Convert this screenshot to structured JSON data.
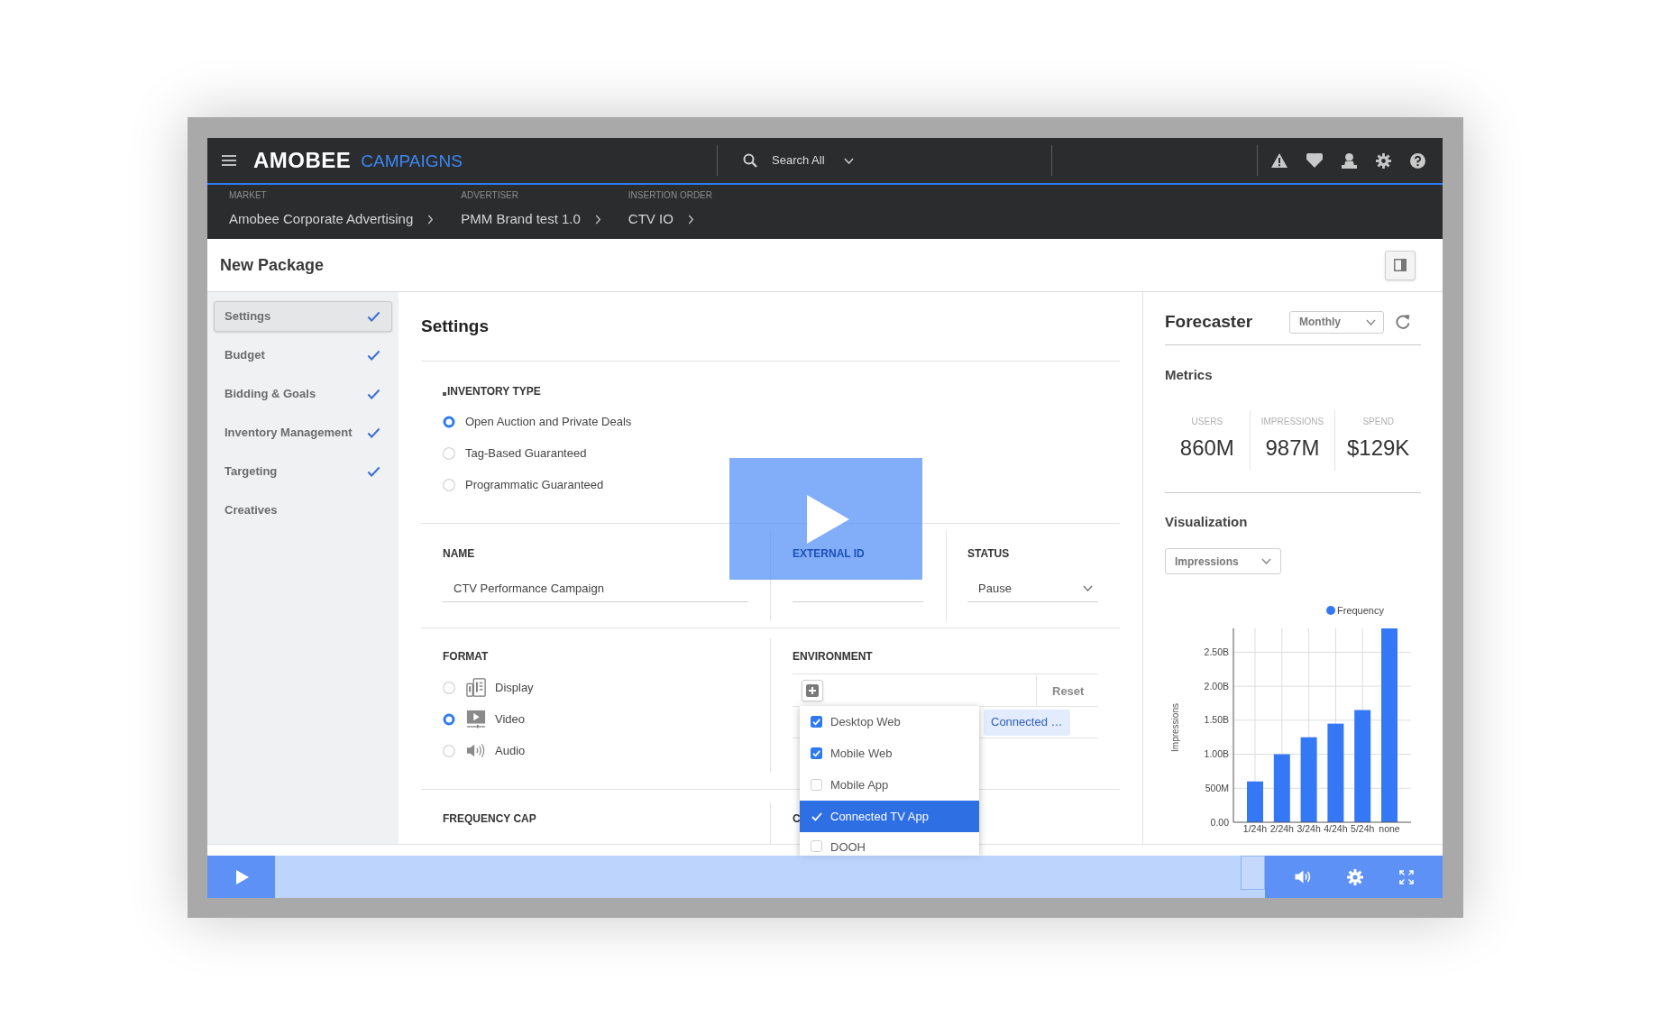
{
  "top_bar": {
    "logo": "AMOBEE",
    "product": "CAMPAIGNS",
    "search": "Search All"
  },
  "breadcrumbs": [
    {
      "label": "MARKET",
      "value": "Amobee Corporate Advertising"
    },
    {
      "label": "ADVERTISER",
      "value": "PMM Brand test 1.0"
    },
    {
      "label": "INSERTION ORDER",
      "value": "CTV IO"
    }
  ],
  "page_title": "New Package",
  "steps": [
    {
      "label": "Settings",
      "selected": true,
      "completed": true
    },
    {
      "label": "Budget",
      "selected": false,
      "completed": true
    },
    {
      "label": "Bidding & Goals",
      "selected": false,
      "completed": true
    },
    {
      "label": "Inventory Management",
      "selected": false,
      "completed": true
    },
    {
      "label": "Targeting",
      "selected": false,
      "completed": true
    },
    {
      "label": "Creatives",
      "selected": false,
      "completed": false
    }
  ],
  "settings": {
    "title": "Settings",
    "inventory_type": {
      "label": "INVENTORY TYPE",
      "required": true,
      "options": [
        {
          "label": "Open Auction and Private Deals",
          "selected": true
        },
        {
          "label": "Tag-Based Guaranteed",
          "selected": false
        },
        {
          "label": "Programmatic Guaranteed",
          "selected": false
        }
      ]
    },
    "name": {
      "label": "NAME",
      "value": "CTV Performance Campaign"
    },
    "external_id": {
      "label": "EXTERNAL ID"
    },
    "status": {
      "label": "STATUS",
      "value": "Pause"
    },
    "format": {
      "label": "FORMAT",
      "options": [
        {
          "kind": "display",
          "label": "Display",
          "selected": false
        },
        {
          "kind": "video",
          "label": "Video",
          "selected": true
        },
        {
          "kind": "audio",
          "label": "Audio",
          "selected": false
        }
      ]
    },
    "environment": {
      "label": "ENVIRONMENT",
      "reset": "Reset",
      "chips": [
        "Connected …"
      ],
      "menu": [
        {
          "label": "Desktop Web",
          "checked": true,
          "selected": false
        },
        {
          "label": "Mobile Web",
          "checked": true,
          "selected": false
        },
        {
          "label": "Mobile App",
          "checked": false,
          "selected": false
        },
        {
          "label": "Connected TV App",
          "checked": true,
          "selected": true
        },
        {
          "label": "DOOH",
          "checked": false,
          "selected": false
        }
      ]
    },
    "frequency_cap": {
      "label": "FREQUENCY CAP"
    },
    "column_4": {
      "label": "C"
    }
  },
  "forecaster": {
    "title": "Forecaster",
    "period": "Monthly",
    "metrics_title": "Metrics",
    "metrics": [
      {
        "label": "USERS",
        "value": "860M"
      },
      {
        "label": "IMPRESSIONS",
        "value": "987M"
      },
      {
        "label": "SPEND",
        "value": "$129K"
      }
    ],
    "visualization_title": "Visualization",
    "measure": "Impressions",
    "chart_data": {
      "type": "bar",
      "ylabel": "Impressions",
      "grid": true,
      "categories": [
        "1/24h",
        "2/24h",
        "3/24h",
        "4/24h",
        "5/24h",
        "none"
      ],
      "series": [
        {
          "name": "Frequency",
          "color": "#3478f6",
          "values": [
            600000000,
            1000000000,
            1250000000,
            1450000000,
            1650000000,
            2850000000
          ]
        }
      ],
      "ylim": [
        0,
        2850000000
      ],
      "yticks": [
        {
          "value": 0,
          "label": "0.00"
        },
        {
          "value": 500000000,
          "label": "500M"
        },
        {
          "value": 1000000000,
          "label": "1.00B"
        },
        {
          "value": 1500000000,
          "label": "1.50B"
        },
        {
          "value": 2000000000,
          "label": "2.00B"
        },
        {
          "value": 2500000000,
          "label": "2.50B"
        }
      ]
    }
  }
}
